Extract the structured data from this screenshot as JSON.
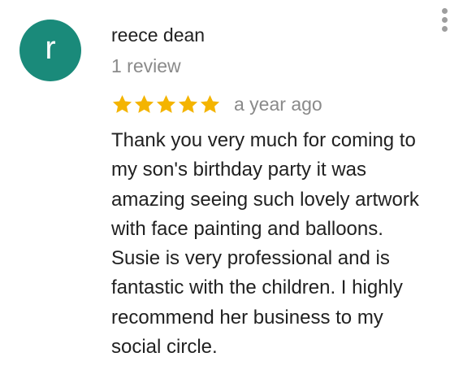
{
  "reviewer": {
    "initial": "r",
    "name": "reece dean",
    "review_count": "1 review",
    "avatar_color": "#1a8a7a"
  },
  "rating": {
    "stars": 5,
    "max": 5,
    "star_color": "#f4b400",
    "date": "a year ago"
  },
  "review": {
    "lines": [
      "Thank you very much for coming to",
      "my son's birthday party it was",
      "amazing seeing such lovely artwork",
      "with face painting and balloons.",
      "Susie is very professional and is",
      "fantastic with the children. I highly",
      "recommend her business to my",
      "social circle."
    ]
  },
  "menu": {
    "icon": "more-vert-icon"
  }
}
